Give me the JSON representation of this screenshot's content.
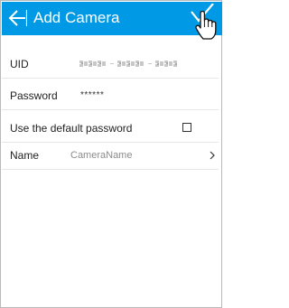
{
  "header": {
    "title": "Add Camera",
    "back_icon": "arrow-left-icon",
    "confirm_icon": "checkmark-icon",
    "bg_color": "#0099e6"
  },
  "form": {
    "uid": {
      "label": "UID",
      "value_obscured": true
    },
    "password": {
      "label": "Password",
      "value": "******"
    },
    "default_password": {
      "label": "Use the default password",
      "checked": false
    },
    "name": {
      "label": "Name",
      "placeholder": "CameraName",
      "chevron_icon": "chevron-right-icon"
    }
  }
}
